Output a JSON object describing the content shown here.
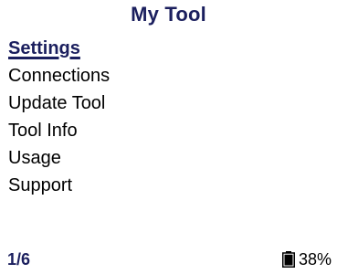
{
  "header": {
    "title": "My Tool"
  },
  "menu": {
    "items": [
      {
        "label": "Settings",
        "selected": true
      },
      {
        "label": "Connections",
        "selected": false
      },
      {
        "label": "Update Tool",
        "selected": false
      },
      {
        "label": "Tool Info",
        "selected": false
      },
      {
        "label": "Usage",
        "selected": false
      },
      {
        "label": "Support",
        "selected": false
      }
    ]
  },
  "footer": {
    "page_indicator": "1/6",
    "battery_icon": "battery-icon",
    "battery_level": "38%"
  },
  "colors": {
    "accent": "#1b1f5e",
    "text": "#000000",
    "background": "#ffffff"
  }
}
